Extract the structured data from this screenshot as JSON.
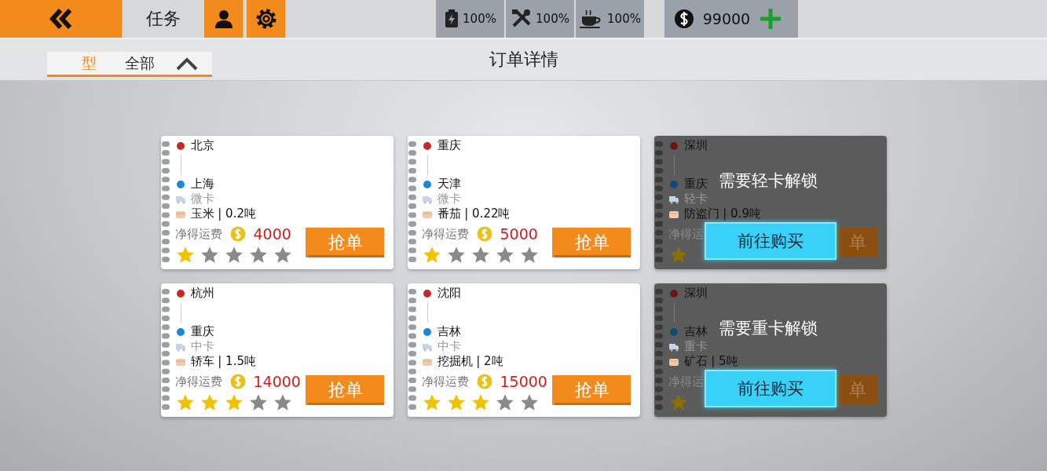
{
  "top_bar": {
    "tab_label": "任务",
    "resources": [
      {
        "kind": "fuel",
        "value": "100%"
      },
      {
        "kind": "repair",
        "value": "100%"
      },
      {
        "kind": "coffee",
        "value": "100%"
      }
    ],
    "money": "99000"
  },
  "sub_bar": {
    "filter_label": "型",
    "filter_value": "全部",
    "title": "订单详情"
  },
  "cards": [
    {
      "kind": "order",
      "from": "北京",
      "to": "上海",
      "truck": "微卡",
      "cargo": "玉米 | 0.2吨",
      "fee_label": "净得运费",
      "fee": "4000",
      "stars": 1,
      "grab_label": "抢单"
    },
    {
      "kind": "order",
      "from": "重庆",
      "to": "天津",
      "truck": "微卡",
      "cargo": "番茄 | 0.22吨",
      "fee_label": "净得运费",
      "fee": "5000",
      "stars": 1,
      "grab_label": "抢单"
    },
    {
      "kind": "locked",
      "from": "深圳",
      "to": "重庆",
      "truck": "轻卡",
      "cargo": "防盗门 | 0.9吨",
      "fee_label": "净得运",
      "grab_label": "单",
      "lock_text": "需要轻卡解锁",
      "buy_label": "前往购买"
    },
    {
      "kind": "order",
      "from": "杭州",
      "to": "重庆",
      "truck": "中卡",
      "cargo": "轿车 | 1.5吨",
      "fee_label": "净得运费",
      "fee": "14000",
      "stars": 3,
      "grab_label": "抢单"
    },
    {
      "kind": "order",
      "from": "沈阳",
      "to": "吉林",
      "truck": "中卡",
      "cargo": "挖掘机 | 2吨",
      "fee_label": "净得运费",
      "fee": "15000",
      "stars": 3,
      "grab_label": "抢单"
    },
    {
      "kind": "locked",
      "from": "深圳",
      "to": "吉林",
      "truck": "重卡",
      "cargo": "矿石 | 5吨",
      "fee_label": "净得运",
      "grab_label": "单",
      "lock_text": "需要重卡解锁",
      "buy_label": "前往购买"
    }
  ]
}
